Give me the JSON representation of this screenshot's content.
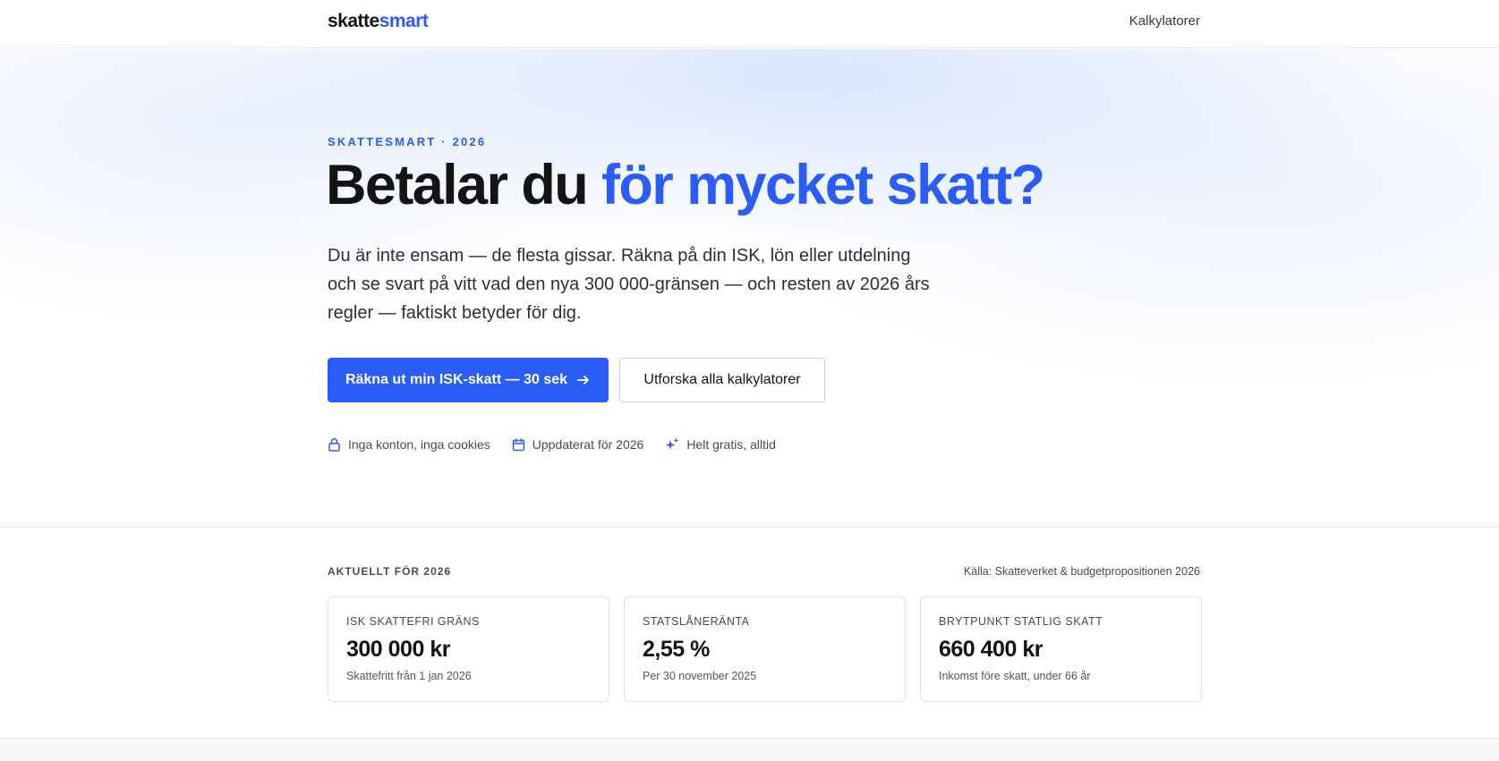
{
  "header": {
    "logo_part1": "skatte",
    "logo_part2": "smart",
    "nav_link": "Kalkylatorer"
  },
  "hero": {
    "eyebrow": "SKATTESMART · 2026",
    "headline_dark": "Betalar du ",
    "headline_blue": "för mycket skatt?",
    "lead": "Du är inte ensam — de flesta gissar. Räkna på din ISK, lön eller utdelning och se svart på vitt vad den nya 300 000-gränsen — och resten av 2026 års regler — faktiskt betyder för dig.",
    "primary_button": "Räkna ut min ISK-skatt — 30 sek",
    "secondary_button": "Utforska alla kalkylatorer",
    "trust": [
      {
        "icon": "lock-icon",
        "label": "Inga konton, inga cookies"
      },
      {
        "icon": "calendar-icon",
        "label": "Uppdaterat för 2026"
      },
      {
        "icon": "sparkle-icon",
        "label": "Helt gratis, alltid"
      }
    ]
  },
  "stats": {
    "title": "AKTUELLT FÖR 2026",
    "source": "Källa: Skatteverket & budgetpropositionen 2026",
    "cards": [
      {
        "label": "ISK SKATTEFRI GRÄNS",
        "value": "300 000 kr",
        "note": "Skattefritt från 1 jan 2026"
      },
      {
        "label": "STATSLÅNERÄNTA",
        "value": "2,55 %",
        "note": "Per 30 november 2025"
      },
      {
        "label": "BRYTPUNKT STATLIG SKATT",
        "value": "660 400 kr",
        "note": "Inkomst före skatt, under 66 år"
      }
    ]
  },
  "colors": {
    "accent": "#2b5cf6",
    "text": "#141414"
  }
}
